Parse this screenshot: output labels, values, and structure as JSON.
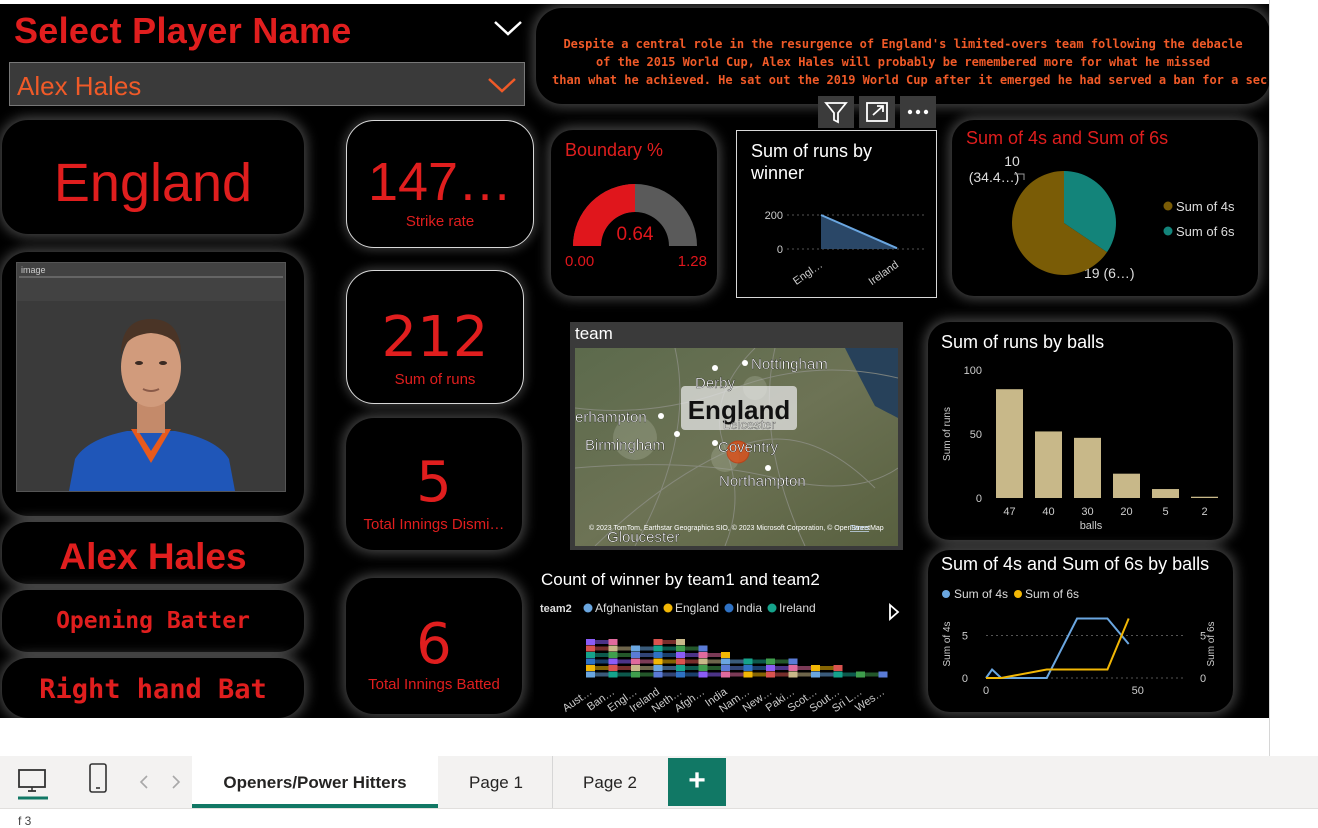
{
  "slicer": {
    "title": "Select Player Name",
    "selected": "Alex Hales"
  },
  "description": {
    "lines": [
      "Despite a central role in the resurgence of England's limited-overs team following the debacle",
      "of the 2015 World Cup, Alex Hales will probably be remembered more for what he missed",
      "than what he achieved. He sat out the 2019 World Cup after it emerged he had served a ban for a secon…"
    ]
  },
  "visual_toolbar": {
    "filter_icon": "filter-icon",
    "focus_icon": "focus-mode-icon",
    "more_icon": "more-options-icon"
  },
  "team_card": {
    "value": "England"
  },
  "kpis": {
    "strike_rate": {
      "value": "147…",
      "label": "Strike rate"
    },
    "sum_runs": {
      "value": "212",
      "label": "Sum of runs"
    },
    "dismissed": {
      "value": "5",
      "label": "Total Innings Dismi…"
    },
    "batted": {
      "value": "6",
      "label": "Total Innings Batted"
    }
  },
  "image_card": {
    "label": "image"
  },
  "player": {
    "name": "Alex Hales",
    "role": "Opening Batter",
    "style": "Right hand Bat"
  },
  "gauge": {
    "title": "Boundary %",
    "value_label": "0.64",
    "min_label": "0.00",
    "max_label": "1.28",
    "value": 0.64,
    "min": 0,
    "max": 1.28
  },
  "runs_by_winner": {
    "title_line1": "Sum of runs by",
    "title_line2": "winner"
  },
  "pie_card": {
    "title": "Sum of 4s and Sum of 6s",
    "label_top_1": "10",
    "label_top_2": "(34.4…)",
    "label_bottom": "19 (6…)",
    "legend": [
      "Sum of 4s",
      "Sum of 6s"
    ]
  },
  "map_card": {
    "title": "team",
    "region_label": "England",
    "cities": [
      "Nottingham",
      "Derby",
      "erhampton",
      "Birmingham",
      "Coventry",
      "Leicester",
      "Northampton",
      "Gloucester"
    ],
    "attribution": "© 2023 TomTom, Earthstar Geographics SIO, © 2023 Microsoft Corporation, © OpenStreetMap",
    "terms": "Terms"
  },
  "runs_by_balls": {
    "title": "Sum of runs by balls"
  },
  "winner_ribbon": {
    "title": "Count of winner by team1 and team2",
    "legend_title": "team2",
    "legend": [
      "Afghanistan",
      "England",
      "India",
      "Ireland"
    ],
    "x_labels": [
      "Aust…",
      "Ban…",
      "Engl…",
      "Ireland",
      "Neth…",
      "Afgh…",
      "India",
      "Nam…",
      "New…",
      "Paki…",
      "Scot…",
      "Sout…",
      "Sri L…",
      "Wes…"
    ]
  },
  "fours_sixes_by_balls": {
    "title": "Sum of 4s and Sum of 6s by balls",
    "legend": [
      "Sum of 4s",
      "Sum of 6s"
    ]
  },
  "colors": {
    "accent_red": "#e01e1e",
    "gauge_red": "#e0161c",
    "gauge_gray": "#5a5a5a",
    "pie_4s": "#7a5c06",
    "pie_6s": "#13847a",
    "bar": "#c8b889",
    "line_4s": "#6aa6e0",
    "line_6s": "#f2b705",
    "ppt_green": "#117865"
  },
  "tabs": {
    "items": [
      "Openers/Power Hitters",
      "Page 1",
      "Page 2"
    ],
    "active": 0,
    "add_label": "+"
  },
  "status": {
    "page_text": "f 3"
  },
  "chart_data": [
    {
      "type": "area",
      "title": "Sum of runs by winner",
      "categories": [
        "Engl…",
        "Ireland"
      ],
      "values": [
        200,
        5
      ],
      "yticks": [
        0,
        200
      ],
      "ylim": [
        0,
        250
      ]
    },
    {
      "type": "pie",
      "title": "Sum of 4s and Sum of 6s",
      "categories": [
        "Sum of 4s",
        "Sum of 6s"
      ],
      "values": [
        19,
        10
      ]
    },
    {
      "type": "bar",
      "title": "Sum of runs by balls",
      "xlabel": "balls",
      "ylabel": "Sum of runs",
      "categories": [
        "47",
        "40",
        "30",
        "20",
        "5",
        "2"
      ],
      "values": [
        85,
        52,
        47,
        19,
        7,
        1
      ],
      "yticks": [
        0,
        50,
        100
      ],
      "ylim": [
        0,
        100
      ]
    },
    {
      "type": "line",
      "title": "Sum of 4s and Sum of 6s by balls",
      "xticks": [
        0,
        50
      ],
      "xlim": [
        0,
        56
      ],
      "ylim": [
        0,
        8
      ],
      "yticks": [
        0,
        5
      ],
      "ylabel_left": "Sum of 4s",
      "ylabel_right": "Sum of 6s",
      "series": [
        {
          "name": "Sum of 4s",
          "x": [
            0,
            2,
            5,
            20,
            30,
            40,
            47
          ],
          "y": [
            0,
            1,
            0,
            0,
            7,
            7,
            4
          ]
        },
        {
          "name": "Sum of 6s",
          "x": [
            0,
            2,
            5,
            20,
            30,
            40,
            47
          ],
          "y": [
            0,
            0,
            0,
            1,
            1,
            1,
            7
          ]
        }
      ]
    }
  ]
}
